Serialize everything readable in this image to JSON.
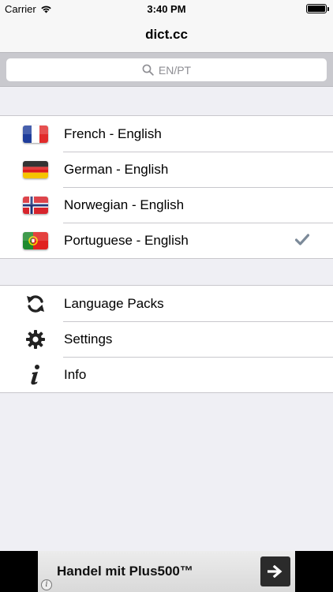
{
  "status_bar": {
    "carrier": "Carrier",
    "time": "3:40 PM"
  },
  "nav_bar": {
    "title": "dict.cc"
  },
  "search": {
    "placeholder": "EN/PT"
  },
  "languages": [
    {
      "label": "French - English",
      "flag": "fr",
      "selected": false
    },
    {
      "label": "German - English",
      "flag": "de",
      "selected": false
    },
    {
      "label": "Norwegian - English",
      "flag": "no",
      "selected": false
    },
    {
      "label": "Portuguese - English",
      "flag": "pt",
      "selected": true
    }
  ],
  "menu": [
    {
      "label": "Language Packs",
      "icon": "refresh-icon"
    },
    {
      "label": "Settings",
      "icon": "gear-icon"
    },
    {
      "label": "Info",
      "icon": "info-icon"
    }
  ],
  "ad": {
    "text": "Handel mit Plus500™",
    "info_glyph": "i"
  },
  "colors": {
    "background": "#efeff4",
    "separator": "#c8c7cc",
    "placeholder": "#8e8e93",
    "checkmark": "#7c8a99"
  }
}
